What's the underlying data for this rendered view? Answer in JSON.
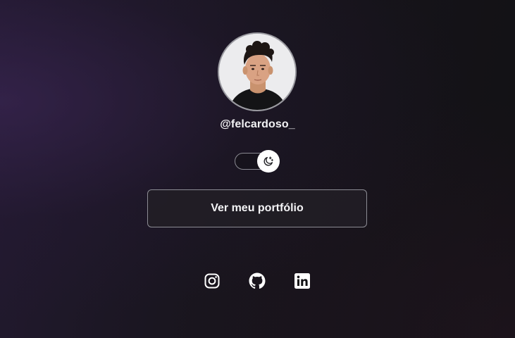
{
  "profile": {
    "username": "@felcardoso_"
  },
  "theme_toggle": {
    "icon": "moon-stars-icon",
    "state": "dark"
  },
  "portfolio_button": {
    "label": "Ver meu portfólio"
  },
  "socials": [
    {
      "icon": "instagram-icon"
    },
    {
      "icon": "github-icon"
    },
    {
      "icon": "linkedin-icon"
    }
  ],
  "colors": {
    "text": "#ffffff",
    "background_dark": "#121114",
    "background_accent": "#231a31",
    "border": "#8c8c94"
  }
}
